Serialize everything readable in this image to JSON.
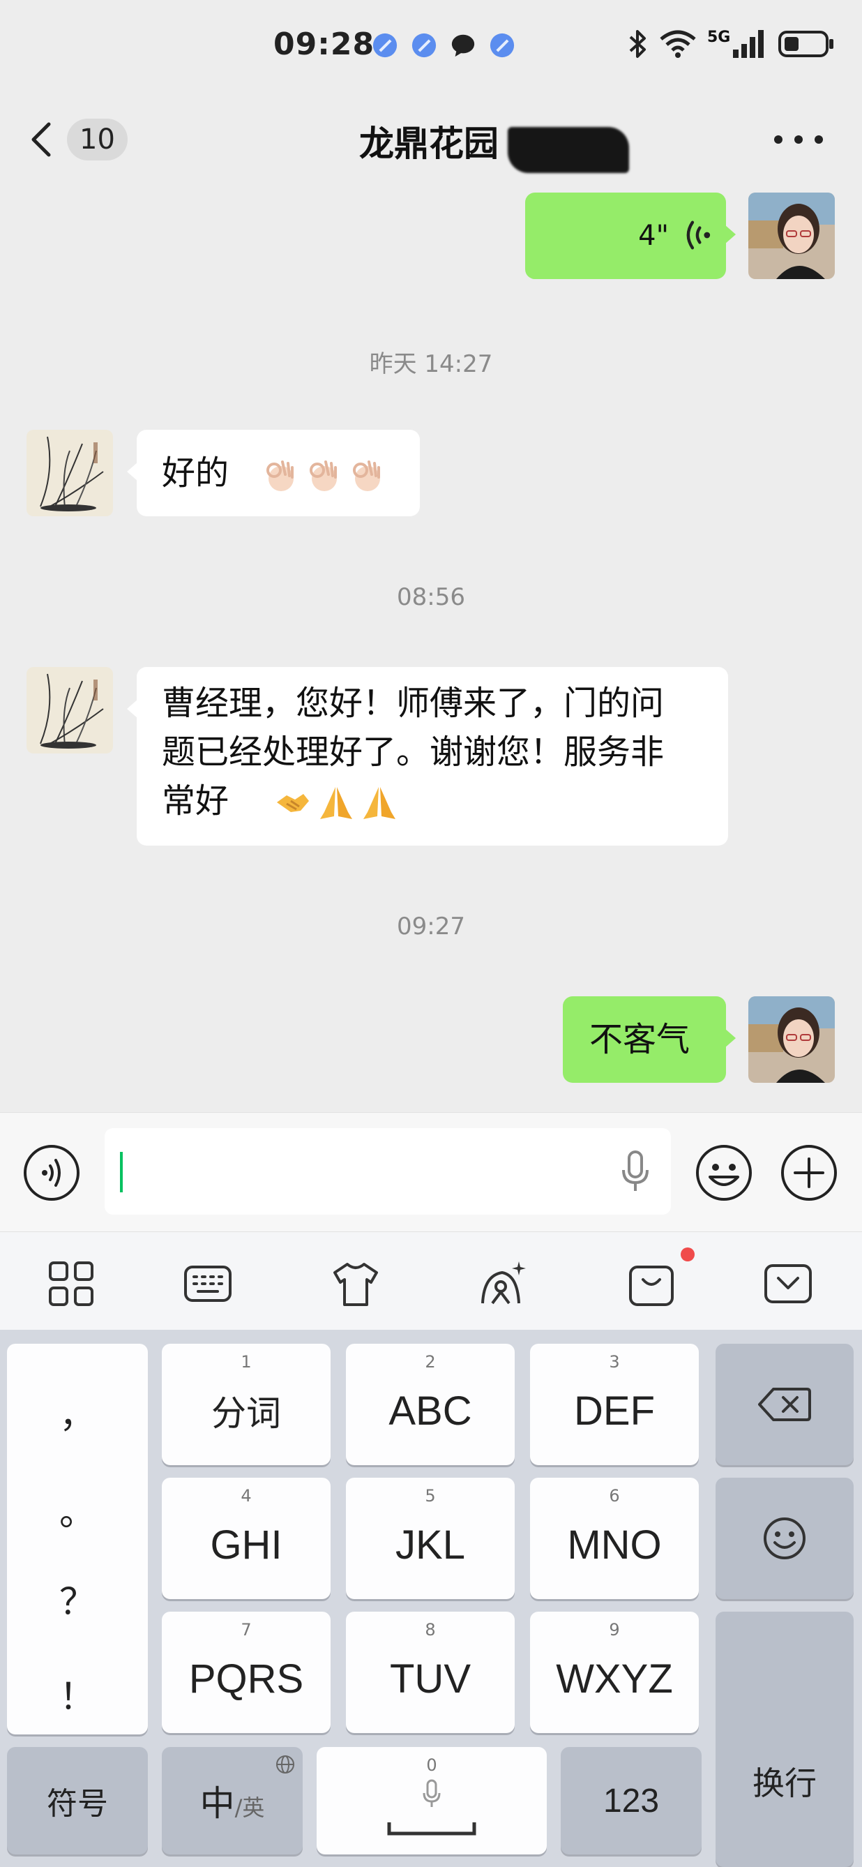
{
  "status_bar": {
    "time": "09:28",
    "network": "5G",
    "notification_icons": [
      "app-notification-icon",
      "app-notification-icon",
      "chat-bubble-icon",
      "app-notification-icon"
    ]
  },
  "nav": {
    "unread_count": "10",
    "title": "龙鼎花园",
    "title_redacted": true
  },
  "messages": [
    {
      "type": "voice",
      "direction": "out",
      "duration": "4\""
    },
    {
      "type": "timestamp",
      "text": "昨天 14:27"
    },
    {
      "type": "text",
      "direction": "in",
      "text": "好的",
      "emojis": [
        "ok-hand",
        "ok-hand",
        "ok-hand"
      ]
    },
    {
      "type": "timestamp",
      "text": "08:56"
    },
    {
      "type": "text",
      "direction": "in",
      "lines": [
        "曹经理，您好！师傅来了，门的问",
        "题已经处理好了。谢谢您！服务非",
        "常好"
      ],
      "emojis": [
        "handshake",
        "folded-hands",
        "folded-hands"
      ]
    },
    {
      "type": "timestamp",
      "text": "09:27"
    },
    {
      "type": "text",
      "direction": "out",
      "text": "不客气"
    }
  ],
  "input": {
    "value": ""
  },
  "keyboard": {
    "toolbar_icons": [
      "grid-icon",
      "keyboard-icon",
      "tshirt-icon",
      "magic-icon",
      "shopping-bag-icon",
      "collapse-icon"
    ],
    "punctuation": [
      "，",
      "。",
      "？",
      "！"
    ],
    "keys": [
      {
        "num": "1",
        "label": "分词"
      },
      {
        "num": "2",
        "label": "ABC"
      },
      {
        "num": "3",
        "label": "DEF"
      },
      {
        "num": "4",
        "label": "GHI"
      },
      {
        "num": "5",
        "label": "JKL"
      },
      {
        "num": "6",
        "label": "MNO"
      },
      {
        "num": "7",
        "label": "PQRS"
      },
      {
        "num": "8",
        "label": "TUV"
      },
      {
        "num": "9",
        "label": "WXYZ"
      }
    ],
    "symbols_label": "符号",
    "lang_main": "中",
    "lang_alt": "/英",
    "space_num": "0",
    "numbers_label": "123",
    "enter_label": "换行"
  },
  "colors": {
    "background": "#ededed",
    "outgoing_bubble": "#95ec69",
    "incoming_bubble": "#ffffff",
    "caret": "#07c160",
    "badge_dot": "#f04b4b"
  }
}
